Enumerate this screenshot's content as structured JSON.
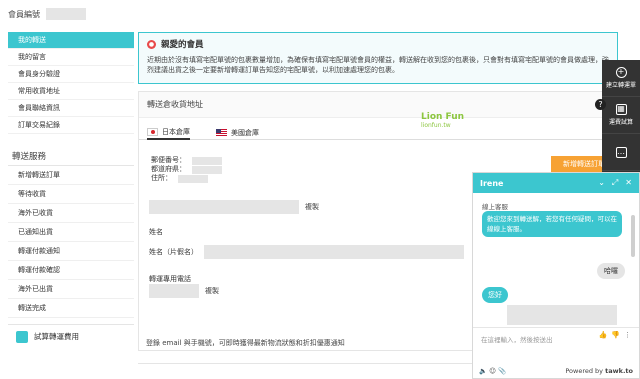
{
  "header": {
    "member_label": "會員編號"
  },
  "sidebar": {
    "account_items": [
      {
        "label": "我的轉送",
        "active": true
      },
      {
        "label": "我的留言",
        "active": false
      },
      {
        "label": "會員身分驗證",
        "active": false
      },
      {
        "label": "常用收貨地址",
        "active": false
      },
      {
        "label": "會員聯絡資訊",
        "active": false
      },
      {
        "label": "訂單交易紀錄",
        "active": false
      }
    ],
    "service_title": "轉送服務",
    "service_items": [
      {
        "label": "新增轉送訂單"
      },
      {
        "label": "等待收貨"
      },
      {
        "label": "海外已收貨"
      },
      {
        "label": "已通知出貨"
      },
      {
        "label": "轉運付款通知"
      },
      {
        "label": "轉運付款確認"
      },
      {
        "label": "海外已出貨"
      },
      {
        "label": "轉送完成"
      }
    ],
    "card_label": "試算轉運費用"
  },
  "notice": {
    "icon": "member-icon",
    "title": "親愛的會員",
    "body": "近期由於沒有填寫宅配單號的包裹數量增加，為確保有填寫宅配單號會員的權益，轉送解在收到您的包裹後，只會對有填寫宅配單號的會員做處理，強烈建議出貨之後一定要新增轉運訂單告知您的宅配單號，以利加速處理您的包裹。"
  },
  "address": {
    "title": "轉送倉收貨地址",
    "tabs": [
      {
        "label": "日本倉庫",
        "flag": "jp",
        "active": true
      },
      {
        "label": "美國倉庫",
        "flag": "us",
        "active": false
      }
    ],
    "logo": {
      "text": "Lion Fun",
      "sub": "lionfun.tw"
    },
    "add_order_button": "新增轉送訂單",
    "postal_label": "郵便番号：",
    "prefecture_label": "都道府県：",
    "address_label": "住所：",
    "copy_label": "複製",
    "name_label": "姓名",
    "name_kana_label": "姓名（片假名）",
    "phone_label": "轉運專用電話",
    "copy_label_2": "複製"
  },
  "footer": {
    "email_text": "登錄 email 與手機號，可即時獲得最新物流狀態和折扣優惠通知"
  },
  "rail": {
    "items": [
      {
        "label": "建立轉運單",
        "icon": "plus-circle-icon"
      },
      {
        "label": "運費試算",
        "icon": "calculator-icon"
      },
      {
        "label": "",
        "icon": "chat-bubble-icon"
      }
    ],
    "help_icon": "?"
  },
  "chat": {
    "agent": "Irene",
    "agent_status": "線上客服",
    "welcome": "歡迎您來到轉送解，若您有任何疑問，可以在線線上客服。",
    "visitor_msg": "哈囉",
    "agent_reply": "您好",
    "input_placeholder": "在這裡輸入，然後按送出",
    "powered_by": "Powered by",
    "brand": "tawk.to"
  },
  "colors": {
    "accent": "#3cc6cf",
    "orange": "#f7a234",
    "rail": "#333333"
  }
}
